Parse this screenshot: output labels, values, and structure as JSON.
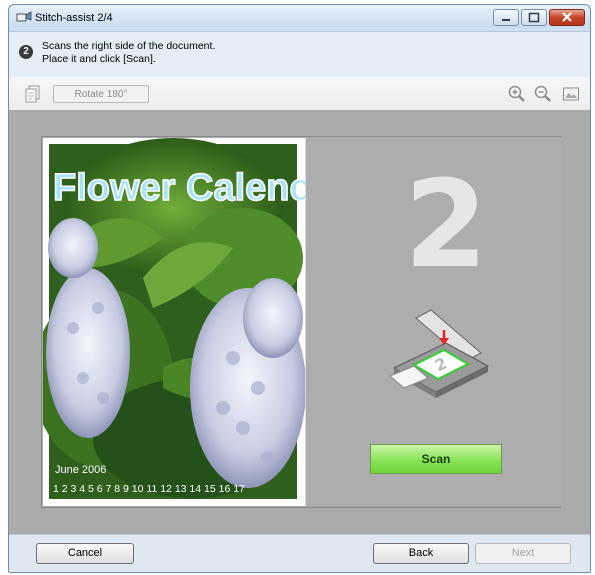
{
  "window": {
    "title": "Stitch-assist 2/4"
  },
  "instruction": {
    "step_number": "2",
    "line1": "Scans the right side of the document.",
    "line2": "Place it and click [Scan]."
  },
  "toolbar": {
    "rotate_label": "Rotate 180°"
  },
  "preview": {
    "photo_title": "Flower Calenc",
    "photo_date": "June 2006",
    "calendar_days": "1 2 3 4 5 6 7 8 9 10 11 12 13 14 15 16 17",
    "side_number": "2",
    "scanner_label": "2",
    "scan_button_label": "Scan"
  },
  "footer": {
    "cancel_label": "Cancel",
    "back_label": "Back",
    "next_label": "Next"
  },
  "colors": {
    "workspace_bg": "#ababab",
    "scan_button": "#86e357",
    "photo_title": "#a8e4f6",
    "close_button": "#c8452a"
  }
}
